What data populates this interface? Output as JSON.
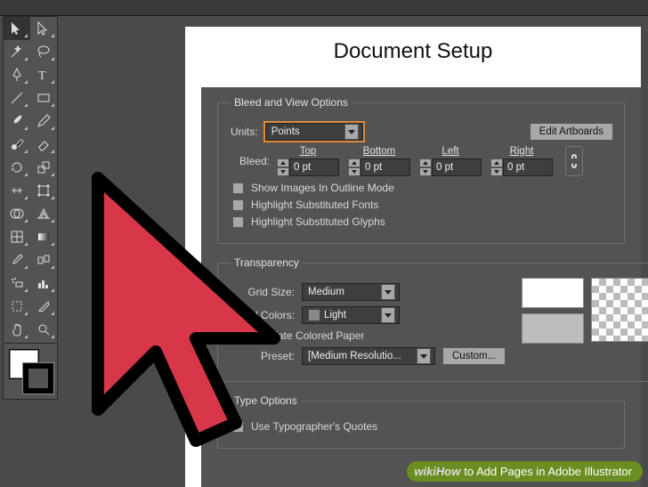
{
  "dialog": {
    "title": "Document Setup",
    "sections": {
      "bleed": {
        "legend": "Bleed and View Options",
        "units_label": "Units:",
        "units_value": "Points",
        "edit_artboards": "Edit Artboards",
        "bleed_label": "Bleed:",
        "cols": {
          "top": "Top",
          "bottom": "Bottom",
          "left": "Left",
          "right": "Right"
        },
        "values": {
          "top": "0 pt",
          "bottom": "0 pt",
          "left": "0 pt",
          "right": "0 pt"
        },
        "chk_outline": "Show Images In Outline Mode",
        "chk_fonts": "Highlight Substituted Fonts",
        "chk_glyphs": "Highlight Substituted Glyphs"
      },
      "transparency": {
        "legend": "Transparency",
        "grid_size_label": "Grid Size:",
        "grid_size_value": "Medium",
        "grid_colors_label": "Grid Colors:",
        "grid_colors_value": "Light",
        "simulate": "Simulate Colored Paper",
        "preset_label": "Preset:",
        "preset_value": "[Medium Resolutio...",
        "custom": "Custom..."
      },
      "type": {
        "legend": "Type Options",
        "typographer": "Use Typographer's Quotes"
      }
    }
  },
  "watermark": {
    "brand": "wikiHow",
    "text": " to Add Pages in Adobe Illustrator"
  },
  "tools": {
    "rows": [
      [
        "selection",
        "direct-selection"
      ],
      [
        "magic-wand",
        "lasso"
      ],
      [
        "pen",
        "type"
      ],
      [
        "line-segment",
        "rectangle"
      ],
      [
        "paintbrush",
        "pencil"
      ],
      [
        "blob-brush",
        "eraser"
      ],
      [
        "rotate",
        "scale"
      ],
      [
        "width",
        "free-transform"
      ],
      [
        "shape-builder",
        "perspective-grid"
      ],
      [
        "mesh",
        "gradient"
      ],
      [
        "eyedropper",
        "blend"
      ],
      [
        "symbol-sprayer",
        "column-graph"
      ],
      [
        "artboard",
        "slice"
      ],
      [
        "hand",
        "zoom"
      ]
    ]
  }
}
